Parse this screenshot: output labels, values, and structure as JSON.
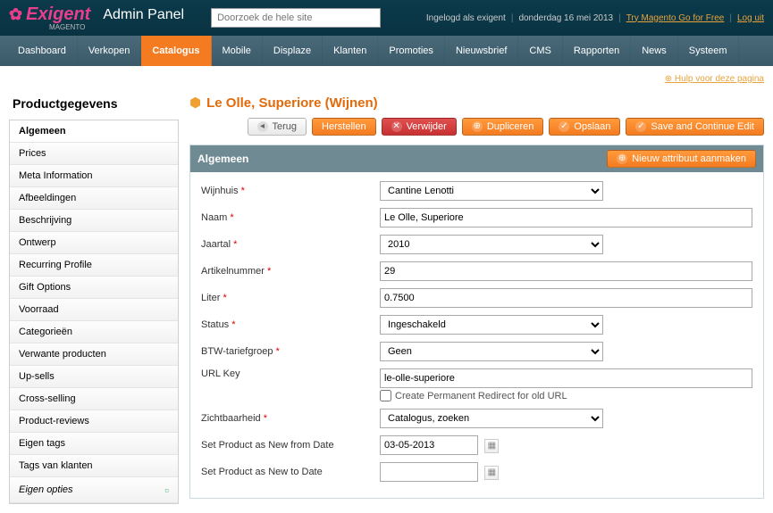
{
  "header": {
    "logo_brand": "Exigent",
    "logo_sub": "Admin Panel",
    "logo_small": "MAGENTO",
    "search_placeholder": "Doorzoek de hele site",
    "logged_in_text": "Ingelogd als exigent",
    "date_text": "donderdag 16 mei 2013",
    "try_link": "Try Magento Go for Free",
    "logout": "Log uit"
  },
  "nav": {
    "items": [
      "Dashboard",
      "Verkopen",
      "Catalogus",
      "Mobile",
      "Displaze",
      "Klanten",
      "Promoties",
      "Nieuwsbrief",
      "CMS",
      "Rapporten",
      "News",
      "Systeem"
    ],
    "active_index": 2,
    "help_text": "Hulp voor deze pagina"
  },
  "sidebar": {
    "title": "Productgegevens",
    "items": [
      {
        "label": "Algemeen",
        "active": true
      },
      {
        "label": "Prices"
      },
      {
        "label": "Meta Information"
      },
      {
        "label": "Afbeeldingen"
      },
      {
        "label": "Beschrijving"
      },
      {
        "label": "Ontwerp"
      },
      {
        "label": "Recurring Profile"
      },
      {
        "label": "Gift Options"
      },
      {
        "label": "Voorraad"
      },
      {
        "label": "Categorieën"
      },
      {
        "label": "Verwante producten"
      },
      {
        "label": "Up-sells"
      },
      {
        "label": "Cross-selling"
      },
      {
        "label": "Product-reviews"
      },
      {
        "label": "Eigen tags"
      },
      {
        "label": "Tags van klanten"
      },
      {
        "label": "Eigen opties",
        "italic": true
      }
    ]
  },
  "page": {
    "title": "Le Olle, Superiore (Wijnen)",
    "buttons": {
      "back": "Terug",
      "reset": "Herstellen",
      "delete": "Verwijder",
      "duplicate": "Dupliceren",
      "save": "Opslaan",
      "save_continue": "Save and Continue Edit"
    }
  },
  "panel": {
    "title": "Algemeen",
    "new_attr": "Nieuw attribuut aanmaken"
  },
  "form": {
    "wijnhuis": {
      "label": "Wijnhuis",
      "required": true,
      "value": "Cantine Lenotti"
    },
    "naam": {
      "label": "Naam",
      "required": true,
      "value": "Le Olle, Superiore"
    },
    "jaartal": {
      "label": "Jaartal",
      "required": true,
      "value": "2010"
    },
    "artikelnummer": {
      "label": "Artikelnummer",
      "required": true,
      "value": "29"
    },
    "liter": {
      "label": "Liter",
      "required": true,
      "value": "0.7500"
    },
    "status": {
      "label": "Status",
      "required": true,
      "value": "Ingeschakeld"
    },
    "btw": {
      "label": "BTW-tariefgroep",
      "required": true,
      "value": "Geen"
    },
    "urlkey": {
      "label": "URL Key",
      "required": false,
      "value": "le-olle-superiore",
      "checkbox_label": "Create Permanent Redirect for old URL"
    },
    "zichtbaarheid": {
      "label": "Zichtbaarheid",
      "required": true,
      "value": "Catalogus, zoeken"
    },
    "new_from": {
      "label": "Set Product as New from Date",
      "value": "03-05-2013"
    },
    "new_to": {
      "label": "Set Product as New to Date",
      "value": ""
    }
  }
}
